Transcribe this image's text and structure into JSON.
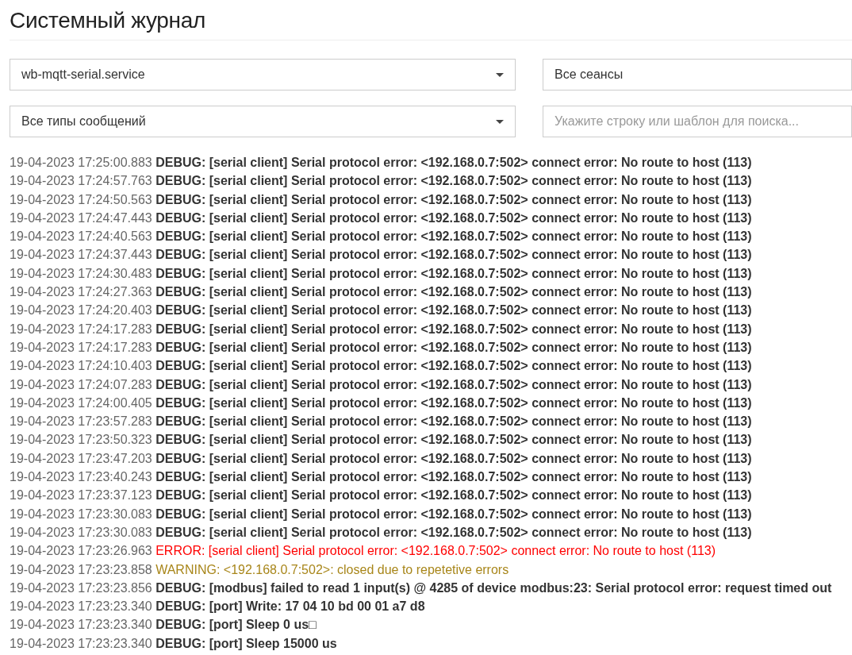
{
  "page": {
    "title": "Системный журнал"
  },
  "filters": [
    {
      "kind": "select",
      "value": "wb-mqtt-serial.service"
    },
    {
      "kind": "input",
      "value": "Все сеансы"
    },
    {
      "kind": "select",
      "value": "Все типы сообщений"
    },
    {
      "kind": "input",
      "placeholder": "Укажите строку или шаблон для поиска..."
    }
  ],
  "log": [
    {
      "time": "19-04-2023 17:25:00.883",
      "kind": "debug",
      "message": "DEBUG: [serial client] Serial protocol error: <192.168.0.7:502> connect error: No route to host (113)"
    },
    {
      "time": "19-04-2023 17:24:57.763",
      "kind": "debug",
      "message": "DEBUG: [serial client] Serial protocol error: <192.168.0.7:502> connect error: No route to host (113)"
    },
    {
      "time": "19-04-2023 17:24:50.563",
      "kind": "debug",
      "message": "DEBUG: [serial client] Serial protocol error: <192.168.0.7:502> connect error: No route to host (113)"
    },
    {
      "time": "19-04-2023 17:24:47.443",
      "kind": "debug",
      "message": "DEBUG: [serial client] Serial protocol error: <192.168.0.7:502> connect error: No route to host (113)"
    },
    {
      "time": "19-04-2023 17:24:40.563",
      "kind": "debug",
      "message": "DEBUG: [serial client] Serial protocol error: <192.168.0.7:502> connect error: No route to host (113)"
    },
    {
      "time": "19-04-2023 17:24:37.443",
      "kind": "debug",
      "message": "DEBUG: [serial client] Serial protocol error: <192.168.0.7:502> connect error: No route to host (113)"
    },
    {
      "time": "19-04-2023 17:24:30.483",
      "kind": "debug",
      "message": "DEBUG: [serial client] Serial protocol error: <192.168.0.7:502> connect error: No route to host (113)"
    },
    {
      "time": "19-04-2023 17:24:27.363",
      "kind": "debug",
      "message": "DEBUG: [serial client] Serial protocol error: <192.168.0.7:502> connect error: No route to host (113)"
    },
    {
      "time": "19-04-2023 17:24:20.403",
      "kind": "debug",
      "message": "DEBUG: [serial client] Serial protocol error: <192.168.0.7:502> connect error: No route to host (113)"
    },
    {
      "time": "19-04-2023 17:24:17.283",
      "kind": "debug",
      "message": "DEBUG: [serial client] Serial protocol error: <192.168.0.7:502> connect error: No route to host (113)"
    },
    {
      "time": "19-04-2023 17:24:17.283",
      "kind": "debug",
      "message": "DEBUG: [serial client] Serial protocol error: <192.168.0.7:502> connect error: No route to host (113)"
    },
    {
      "time": "19-04-2023 17:24:10.403",
      "kind": "debug",
      "message": "DEBUG: [serial client] Serial protocol error: <192.168.0.7:502> connect error: No route to host (113)"
    },
    {
      "time": "19-04-2023 17:24:07.283",
      "kind": "debug",
      "message": "DEBUG: [serial client] Serial protocol error: <192.168.0.7:502> connect error: No route to host (113)"
    },
    {
      "time": "19-04-2023 17:24:00.405",
      "kind": "debug",
      "message": "DEBUG: [serial client] Serial protocol error: <192.168.0.7:502> connect error: No route to host (113)"
    },
    {
      "time": "19-04-2023 17:23:57.283",
      "kind": "debug",
      "message": "DEBUG: [serial client] Serial protocol error: <192.168.0.7:502> connect error: No route to host (113)"
    },
    {
      "time": "19-04-2023 17:23:50.323",
      "kind": "debug",
      "message": "DEBUG: [serial client] Serial protocol error: <192.168.0.7:502> connect error: No route to host (113)"
    },
    {
      "time": "19-04-2023 17:23:47.203",
      "kind": "debug",
      "message": "DEBUG: [serial client] Serial protocol error: <192.168.0.7:502> connect error: No route to host (113)"
    },
    {
      "time": "19-04-2023 17:23:40.243",
      "kind": "debug",
      "message": "DEBUG: [serial client] Serial protocol error: <192.168.0.7:502> connect error: No route to host (113)"
    },
    {
      "time": "19-04-2023 17:23:37.123",
      "kind": "debug",
      "message": "DEBUG: [serial client] Serial protocol error: <192.168.0.7:502> connect error: No route to host (113)"
    },
    {
      "time": "19-04-2023 17:23:30.083",
      "kind": "debug",
      "message": "DEBUG: [serial client] Serial protocol error: <192.168.0.7:502> connect error: No route to host (113)"
    },
    {
      "time": "19-04-2023 17:23:30.083",
      "kind": "debug",
      "message": "DEBUG: [serial client] Serial protocol error: <192.168.0.7:502> connect error: No route to host (113)"
    },
    {
      "time": "19-04-2023 17:23:26.963",
      "kind": "error",
      "message": "ERROR: [serial client] Serial protocol error: <192.168.0.7:502> connect error: No route to host (113)"
    },
    {
      "time": "19-04-2023 17:23:23.858",
      "kind": "warning",
      "message": "WARNING: <192.168.0.7:502>: closed due to repetetive errors"
    },
    {
      "time": "19-04-2023 17:23:23.856",
      "kind": "debug",
      "message": "DEBUG: [modbus] failed to read 1 input(s) @ 4285 of device modbus:23: Serial protocol error: request timed out"
    },
    {
      "time": "19-04-2023 17:23:23.340",
      "kind": "debug",
      "message": "DEBUG: [port] Write: 17 04 10 bd 00 01 a7 d8"
    },
    {
      "time": "19-04-2023 17:23:23.340",
      "kind": "debug",
      "message": "DEBUG: [port] Sleep 0 us□"
    },
    {
      "time": "19-04-2023 17:23:23.340",
      "kind": "debug",
      "message": "DEBUG: [port] Sleep 15000 us"
    }
  ]
}
